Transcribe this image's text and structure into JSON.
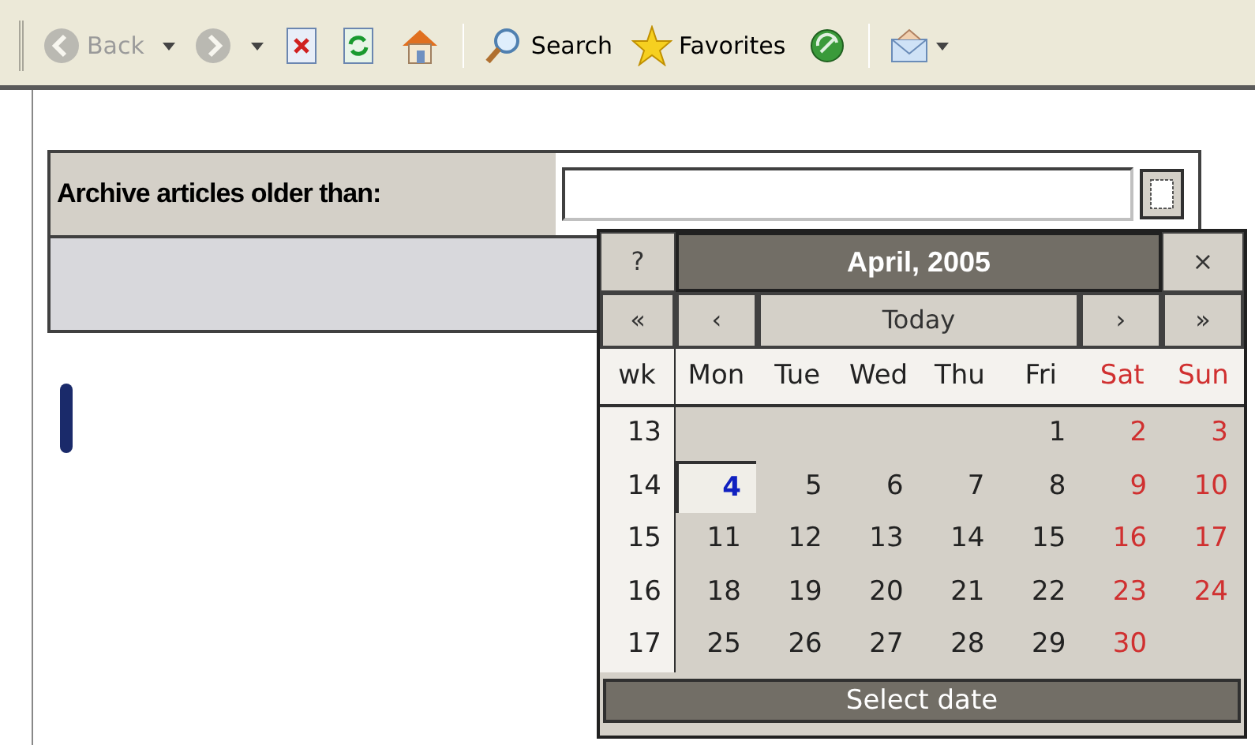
{
  "toolbar": {
    "items": [
      {
        "kind": "nav",
        "label": "Back",
        "disabled": true
      },
      {
        "kind": "nav",
        "disabled": true
      },
      {
        "kind": "icon"
      },
      {
        "kind": "icon"
      },
      {
        "kind": "icon"
      },
      {
        "kind": "separator"
      },
      {
        "kind": "labeled",
        "label": "Search"
      },
      {
        "kind": "labeled",
        "label": "Favorites"
      },
      {
        "kind": "icon"
      },
      {
        "kind": "separator"
      },
      {
        "kind": "menu"
      }
    ]
  },
  "form": {
    "label": "Archive articles older than:"
  },
  "calendar": {
    "help": "?",
    "title": "April, 2005",
    "close": "×",
    "nav": [
      "«",
      "‹",
      "Today",
      "›",
      "»"
    ],
    "week_heading": "wk",
    "day_headings": [
      {
        "label": "Mon",
        "kind": "weekday"
      },
      {
        "label": "Tue",
        "kind": "weekday"
      },
      {
        "label": "Wed",
        "kind": "weekday"
      },
      {
        "label": "Thu",
        "kind": "weekday"
      },
      {
        "label": "Fri",
        "kind": "weekday"
      },
      {
        "label": "Sat",
        "kind": "weekend"
      },
      {
        "label": "Sun",
        "kind": "weekend"
      }
    ],
    "weeks": [
      {
        "number": "13",
        "days": [
          {
            "kind": "blank"
          },
          {
            "kind": "blank"
          },
          {
            "kind": "blank"
          },
          {
            "kind": "blank"
          },
          {
            "label": "1",
            "kind": "weekday",
            "selected": false
          },
          {
            "label": "2",
            "kind": "weekend",
            "selected": false
          },
          {
            "label": "3",
            "kind": "weekend",
            "selected": false
          }
        ]
      },
      {
        "number": "14",
        "days": [
          {
            "label": "4",
            "kind": "weekday",
            "selected": true
          },
          {
            "label": "5",
            "kind": "weekday",
            "selected": false
          },
          {
            "label": "6",
            "kind": "weekday",
            "selected": false
          },
          {
            "label": "7",
            "kind": "weekday",
            "selected": false
          },
          {
            "label": "8",
            "kind": "weekday",
            "selected": false
          },
          {
            "label": "9",
            "kind": "weekend",
            "selected": false
          },
          {
            "label": "10",
            "kind": "weekend",
            "selected": false
          }
        ]
      },
      {
        "number": "15",
        "days": [
          {
            "label": "11",
            "kind": "weekday",
            "selected": false
          },
          {
            "label": "12",
            "kind": "weekday",
            "selected": false
          },
          {
            "label": "13",
            "kind": "weekday",
            "selected": false
          },
          {
            "label": "14",
            "kind": "weekday",
            "selected": false
          },
          {
            "label": "15",
            "kind": "weekday",
            "selected": false
          },
          {
            "label": "16",
            "kind": "weekend",
            "selected": false
          },
          {
            "label": "17",
            "kind": "weekend",
            "selected": false
          }
        ]
      },
      {
        "number": "16",
        "days": [
          {
            "label": "18",
            "kind": "weekday",
            "selected": false
          },
          {
            "label": "19",
            "kind": "weekday",
            "selected": false
          },
          {
            "label": "20",
            "kind": "weekday",
            "selected": false
          },
          {
            "label": "21",
            "kind": "weekday",
            "selected": false
          },
          {
            "label": "22",
            "kind": "weekday",
            "selected": false
          },
          {
            "label": "23",
            "kind": "weekend",
            "selected": false
          },
          {
            "label": "24",
            "kind": "weekend",
            "selected": false
          }
        ]
      },
      {
        "number": "17",
        "days": [
          {
            "label": "25",
            "kind": "weekday",
            "selected": false
          },
          {
            "label": "26",
            "kind": "weekday",
            "selected": false
          },
          {
            "label": "27",
            "kind": "weekday",
            "selected": false
          },
          {
            "label": "28",
            "kind": "weekday",
            "selected": false
          },
          {
            "label": "29",
            "kind": "weekday",
            "selected": false
          },
          {
            "label": "30",
            "kind": "weekend",
            "selected": false
          },
          {
            "kind": "blank"
          }
        ]
      }
    ],
    "status": "Select date"
  }
}
